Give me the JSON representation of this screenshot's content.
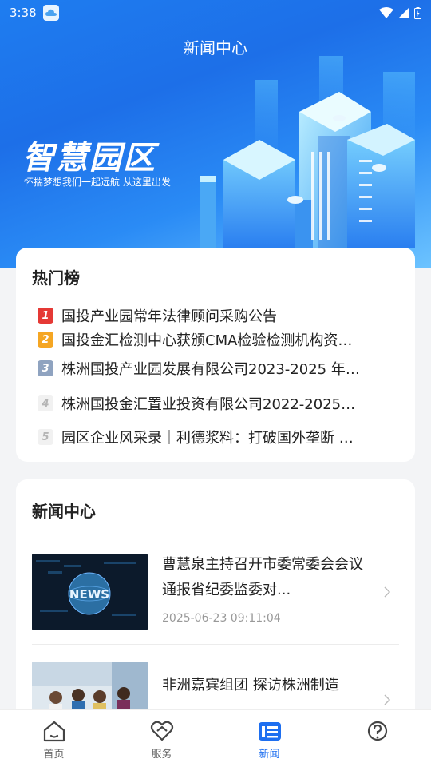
{
  "status_bar": {
    "time": "3:38"
  },
  "header": {
    "title": "新闻中心"
  },
  "banner": {
    "title": "智慧园区",
    "subtitle": "怀揣梦想我们一起远航  从这里出发"
  },
  "hot_list": {
    "title": "热门榜",
    "items": [
      {
        "rank": "1",
        "text": "国投产业园常年法律顾问采购公告",
        "color": "#e53935"
      },
      {
        "rank": "2",
        "text": "国投金汇检测中心获颁CMA检验检测机构资…",
        "color": "#f5a623"
      },
      {
        "rank": "3",
        "text": "株洲国投产业园发展有限公司2023-2025 年…",
        "color": "#8fa3c0"
      },
      {
        "rank": "4",
        "text": "株洲国投金汇置业投资有限公司2022-2025…",
        "color": "#c8c8c8"
      },
      {
        "rank": "5",
        "text": "园区企业风采录｜利德浆料：打破国外垄断 …",
        "color": "#c8c8c8"
      }
    ]
  },
  "news": {
    "title": "新闻中心",
    "items": [
      {
        "headline": "曹慧泉主持召开市委常委会会议 通报省纪委监委对...",
        "date": "2025-06-23 09:11:04",
        "thumb_text": "NEWS"
      },
      {
        "headline": "非洲嘉宾组团 探访株洲制造",
        "date": ""
      }
    ]
  },
  "tabs": [
    {
      "label": "首页",
      "icon": "home-icon"
    },
    {
      "label": "服务",
      "icon": "service-icon"
    },
    {
      "label": "新闻",
      "icon": "news-icon",
      "active": true
    },
    {
      "label": "",
      "icon": "help-icon"
    }
  ],
  "colors": {
    "accent": "#1e6ff0"
  }
}
